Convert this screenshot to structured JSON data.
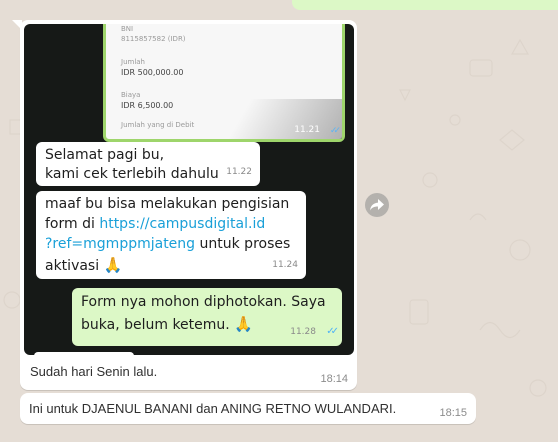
{
  "chat": {
    "media_message": {
      "receipt": {
        "bank": "BNI",
        "account": "8115857582 (IDR)",
        "amount_label": "Jumlah",
        "amount": "IDR 500,000.00",
        "fee_label": "Biaya",
        "fee": "IDR 6,500.00",
        "debit_label": "Jumlah yang di Debit",
        "time": "11.21"
      },
      "bubbles": [
        {
          "line1": "Selamat pagi bu,",
          "line2": "kami cek terlebih dahulu",
          "time": "11.22"
        },
        {
          "line1": "maaf bu bisa melakukan pengisian",
          "line2_pre": "form di ",
          "link1": "https://campusdigital.id",
          "link2": "?ref=mgmppmjateng",
          "line3_post": " untuk proses",
          "line4": "aktivasi",
          "emoji": "🙏",
          "time": "11.24"
        },
        {
          "line1": "Form nya mohon diphotokan.  Saya",
          "line2": "buka, belum ketemu.",
          "emoji": "🙏",
          "time": "11.28"
        }
      ],
      "caption": "Sudah hari Senin lalu.",
      "time": "18:14"
    },
    "text_message": {
      "text": "Ini untuk DJAENUL BANANI dan ANING RETNO WULANDARI.",
      "time": "18:15"
    }
  },
  "colors": {
    "wallpaper": "#e5ddd5",
    "outgoing_bubble": "#dcf8c6",
    "incoming_bubble": "#ffffff",
    "read_ticks": "#4fb3f6",
    "link": "#1aa0d8"
  },
  "icons": {
    "forward": "forward-arrow-icon",
    "read_receipt": "double-check-icon"
  }
}
